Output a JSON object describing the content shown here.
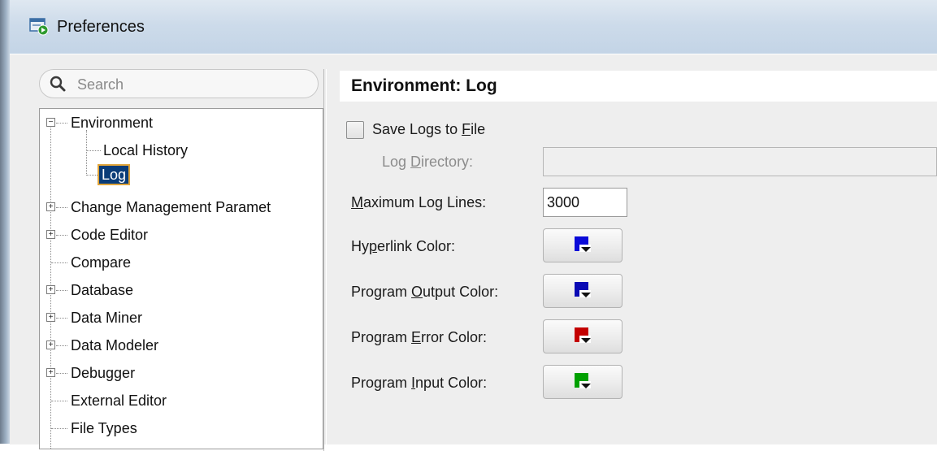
{
  "window": {
    "title": "Preferences"
  },
  "search": {
    "placeholder": "Search"
  },
  "tree": {
    "items": [
      {
        "label": "Environment",
        "expander": "−"
      },
      {
        "label": "Local History"
      },
      {
        "label": "Log",
        "selected": true
      },
      {
        "label": "Change Management Paramet",
        "expander": "+"
      },
      {
        "label": "Code Editor",
        "expander": "+"
      },
      {
        "label": "Compare"
      },
      {
        "label": "Database",
        "expander": "+"
      },
      {
        "label": "Data Miner",
        "expander": "+"
      },
      {
        "label": "Data Modeler",
        "expander": "+"
      },
      {
        "label": "Debugger",
        "expander": "+"
      },
      {
        "label": "External Editor"
      },
      {
        "label": "File Types"
      }
    ]
  },
  "panel": {
    "title": "Environment: Log",
    "save_logs": {
      "pre": "Save Logs to ",
      "u": "F",
      "post": "ile",
      "checked": false
    },
    "log_directory": {
      "pre": "Log ",
      "u": "D",
      "post": "irectory:",
      "value": "",
      "enabled": false
    },
    "max_lines": {
      "pre": "",
      "u": "M",
      "post": "aximum Log Lines:",
      "value": "3000"
    },
    "hyperlink_color": {
      "pre": "Hy",
      "u": "p",
      "post": "erlink Color:",
      "color": "#0a0ad8"
    },
    "output_color": {
      "pre": "Program ",
      "u": "O",
      "post": "utput Color:",
      "color": "#0a0ab4"
    },
    "error_color": {
      "pre": "Program ",
      "u": "E",
      "post": "rror Color:",
      "color": "#c40000"
    },
    "input_color": {
      "pre": "Program ",
      "u": "I",
      "post": "nput Color:",
      "color": "#00a000"
    }
  }
}
